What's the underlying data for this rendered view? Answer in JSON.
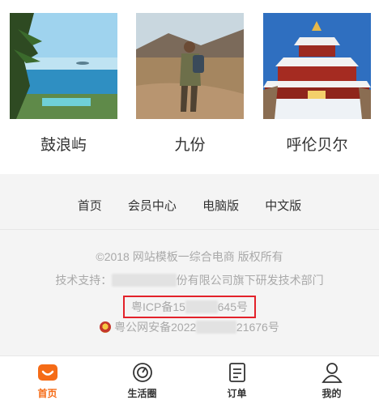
{
  "gallery": [
    {
      "caption": "鼓浪屿",
      "image": "beach-palm-photo"
    },
    {
      "caption": "九份",
      "image": "hiker-woman-photo"
    },
    {
      "caption": "呼伦贝尔",
      "image": "snow-temple-photo"
    }
  ],
  "footer_nav": [
    "首页",
    "会员中心",
    "电脑版",
    "中文版"
  ],
  "footer": {
    "copyright": "©2018 网站模板一综合电商 版权所有",
    "support_prefix": "技术支持：",
    "support_suffix": "份有限公司旗下研发技术部门",
    "icp_prefix": "粤ICP备15",
    "icp_suffix": "645号",
    "police_prefix": "粤公网安备2022",
    "police_suffix": "21676号"
  },
  "tabbar": [
    {
      "label": "首页",
      "icon": "home-smile-icon",
      "active": true
    },
    {
      "label": "生活圈",
      "icon": "life-circle-icon",
      "active": false
    },
    {
      "label": "订单",
      "icon": "order-list-icon",
      "active": false
    },
    {
      "label": "我的",
      "icon": "user-icon",
      "active": false
    }
  ],
  "colors": {
    "accent": "#f56b16",
    "highlight_box": "#e3222a",
    "footer_bg": "#f4f4f4"
  }
}
